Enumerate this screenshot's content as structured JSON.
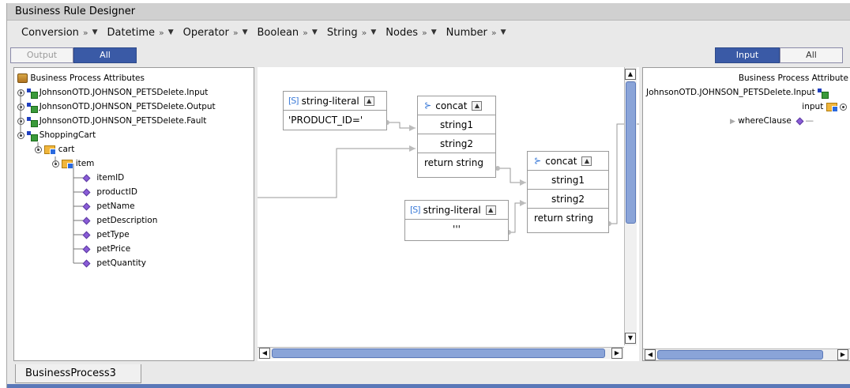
{
  "window": {
    "title": "Business Rule Designer"
  },
  "menubar": {
    "items": [
      {
        "label": "Conversion"
      },
      {
        "label": "Datetime"
      },
      {
        "label": "Operator"
      },
      {
        "label": "Boolean"
      },
      {
        "label": "String"
      },
      {
        "label": "Nodes"
      },
      {
        "label": "Number"
      }
    ],
    "chevron": "»",
    "arrow": "▼"
  },
  "left_toggle": {
    "output_label": "Output",
    "all_label": "All",
    "selected": "All"
  },
  "right_toggle": {
    "input_label": "Input",
    "all_label": "All",
    "selected": "Input"
  },
  "left_tree": {
    "root": "Business Process Attributes",
    "nodes": [
      "JohnsonOTD.JOHNSON_PETSDelete.Input",
      "JohnsonOTD.JOHNSON_PETSDelete.Output",
      "JohnsonOTD.JOHNSON_PETSDelete.Fault",
      "ShoppingCart"
    ],
    "cart": "cart",
    "item": "item",
    "fields": [
      "itemID",
      "productID",
      "petName",
      "petDescription",
      "petType",
      "petPrice",
      "petQuantity"
    ]
  },
  "canvas": {
    "literal1": {
      "title": "string-literal",
      "value": "'PRODUCT_ID='"
    },
    "concat1": {
      "title": "concat",
      "inputs": [
        "string1",
        "string2"
      ],
      "output": "return string"
    },
    "literal2": {
      "title": "string-literal",
      "value": "'''"
    },
    "concat2": {
      "title": "concat",
      "inputs": [
        "string1",
        "string2"
      ],
      "output": "return string"
    },
    "str_icon": "[S]"
  },
  "right_tree": {
    "root": "Business Process Attribute",
    "node": "JohnsonOTD.JOHNSON_PETSDelete.Input",
    "input": "input",
    "where": "whereClause"
  },
  "bottom_tab": {
    "label": "BusinessProcess3"
  },
  "colors": {
    "accent": "#3a5aa6",
    "diamond": "#8a5cd8",
    "thumb": "#8aa4d8"
  }
}
